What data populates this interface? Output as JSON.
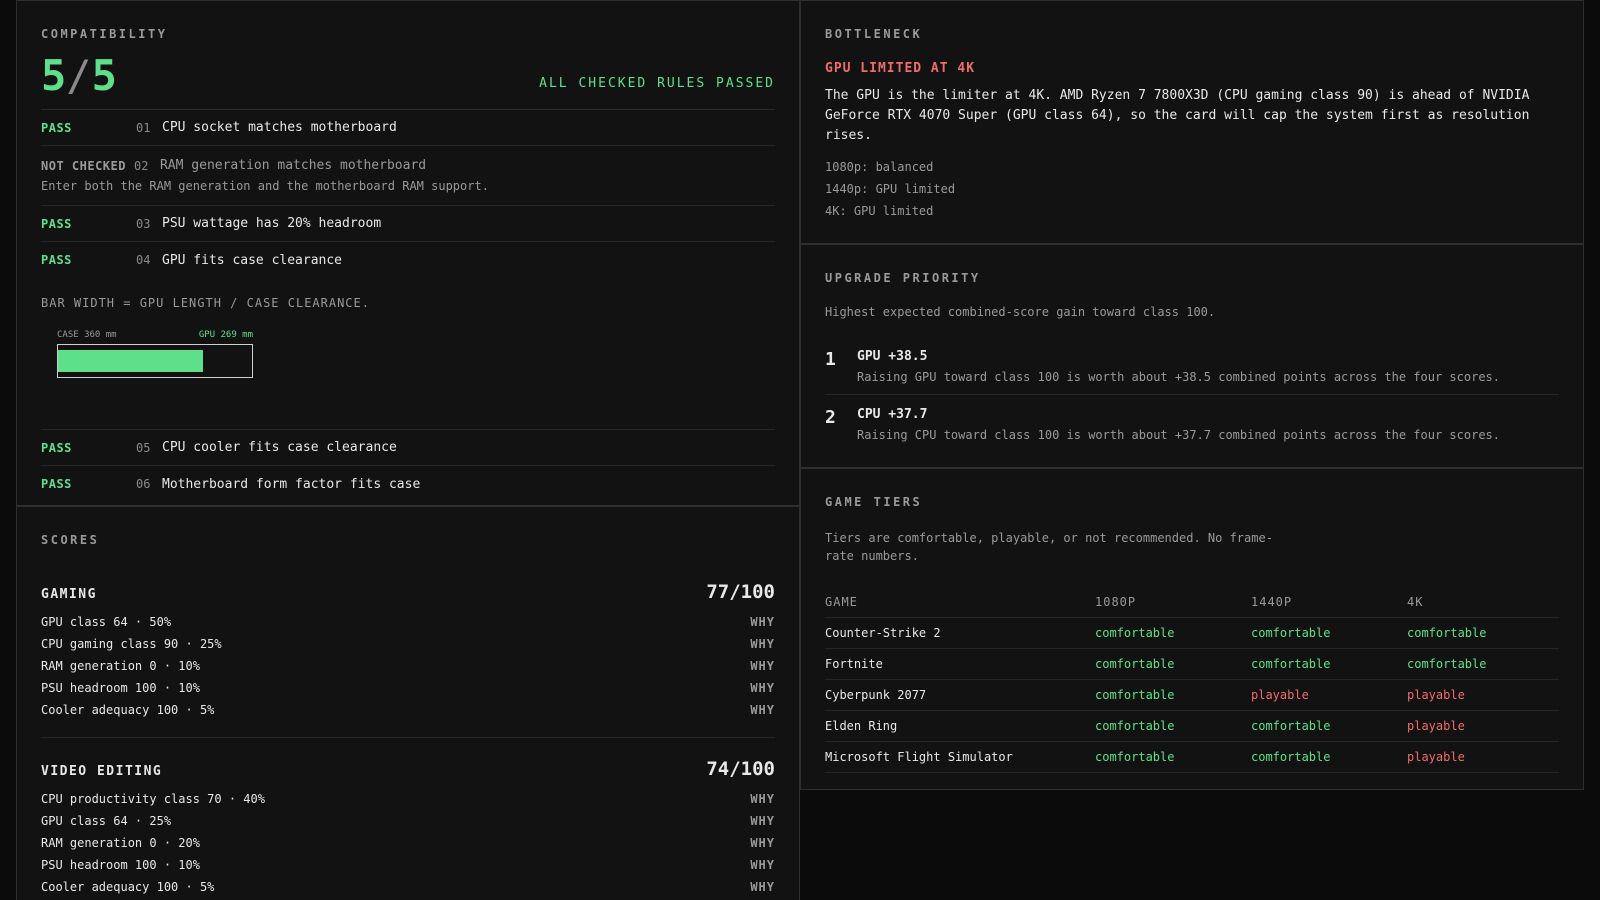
{
  "compatibility": {
    "title": "COMPATIBILITY",
    "score_num": "5",
    "score_sep": "/",
    "score_den": "5",
    "summary": "ALL CHECKED RULES PASSED",
    "rules": [
      {
        "status": "PASS",
        "num": "01",
        "label": "CPU socket matches motherboard"
      },
      {
        "status": "NOT CHECKED",
        "num": "02",
        "label": "RAM generation matches motherboard",
        "hint": "Enter both the RAM generation and the motherboard RAM support."
      },
      {
        "status": "PASS",
        "num": "03",
        "label": "PSU wattage has 20% headroom"
      },
      {
        "status": "PASS",
        "num": "04",
        "label": "GPU fits case clearance"
      },
      {
        "status": "PASS",
        "num": "05",
        "label": "CPU cooler fits case clearance"
      },
      {
        "status": "PASS",
        "num": "06",
        "label": "Motherboard form factor fits case"
      }
    ],
    "bar": {
      "caption": "BAR WIDTH = GPU LENGTH / CASE CLEARANCE.",
      "case_label": "CASE 360 mm",
      "gpu_label": "GPU 269 mm",
      "case_mm": 360,
      "gpu_mm": 269
    }
  },
  "scores": {
    "title": "SCORES",
    "groups": [
      {
        "name": "GAMING",
        "total": "77/100",
        "items": [
          {
            "label": "GPU class 64 · 50%",
            "why": "WHY"
          },
          {
            "label": "CPU gaming class 90 · 25%",
            "why": "WHY"
          },
          {
            "label": "RAM generation 0 · 10%",
            "why": "WHY"
          },
          {
            "label": "PSU headroom 100 · 10%",
            "why": "WHY"
          },
          {
            "label": "Cooler adequacy 100 · 5%",
            "why": "WHY"
          }
        ]
      },
      {
        "name": "VIDEO EDITING",
        "total": "74/100",
        "items": [
          {
            "label": "CPU productivity class 70 · 40%",
            "why": "WHY"
          },
          {
            "label": "GPU class 64 · 25%",
            "why": "WHY"
          },
          {
            "label": "RAM generation 0 · 20%",
            "why": "WHY"
          },
          {
            "label": "PSU headroom 100 · 10%",
            "why": "WHY"
          },
          {
            "label": "Cooler adequacy 100 · 5%",
            "why": "WHY"
          }
        ]
      }
    ]
  },
  "bottleneck": {
    "title": "BOTTLENECK",
    "headline": "GPU LIMITED AT 4K",
    "text": "The GPU is the limiter at 4K. AMD Ryzen 7 7800X3D (CPU gaming class 90) is ahead of NVIDIA GeForce RTX 4070 Super (GPU class 64), so the card will cap the system first as resolution rises.",
    "lines": [
      "1080p: balanced",
      "1440p: GPU limited",
      "4K: GPU limited"
    ]
  },
  "upgrade": {
    "title": "UPGRADE PRIORITY",
    "subtitle": "Highest expected combined-score gain toward class 100.",
    "items": [
      {
        "rank": "1",
        "title": "GPU +38.5",
        "desc": "Raising GPU toward class 100 is worth about +38.5 combined points across the four scores."
      },
      {
        "rank": "2",
        "title": "CPU +37.7",
        "desc": "Raising CPU toward class 100 is worth about +37.7 combined points across the four scores."
      }
    ]
  },
  "tiers": {
    "title": "GAME TIERS",
    "subtitle": "Tiers are comfortable, playable, or not recommended. No frame-rate numbers.",
    "headers": [
      "GAME",
      "1080P",
      "1440P",
      "4K"
    ],
    "rows": [
      [
        "Counter-Strike 2",
        "comfortable",
        "comfortable",
        "comfortable"
      ],
      [
        "Fortnite",
        "comfortable",
        "comfortable",
        "comfortable"
      ],
      [
        "Cyberpunk 2077",
        "comfortable",
        "playable",
        "playable"
      ],
      [
        "Elden Ring",
        "comfortable",
        "comfortable",
        "playable"
      ],
      [
        "Microsoft Flight Simulator",
        "comfortable",
        "comfortable",
        "playable"
      ]
    ]
  },
  "colors": {
    "pass": "#5ee08a",
    "warn": "#f26b6b",
    "muted": "#9a9a9a"
  }
}
